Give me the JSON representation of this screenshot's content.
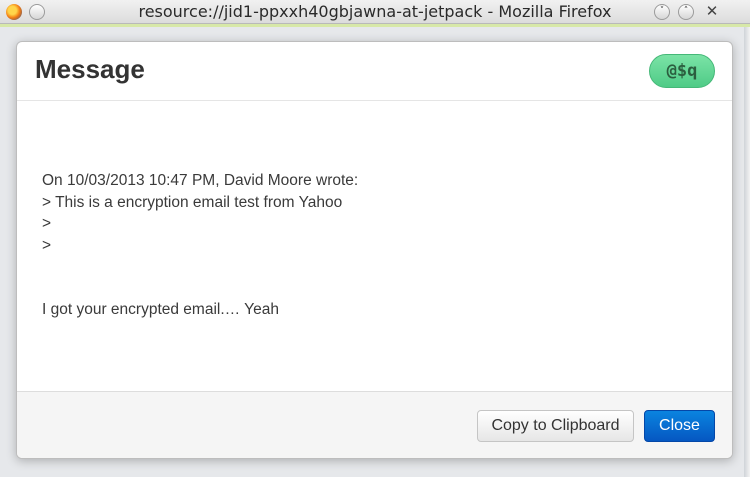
{
  "window": {
    "title": "resource://jid1-ppxxh40gbjawna-at-jetpack - Mozilla Firefox",
    "min_symbol": "˅",
    "max_symbol": "˄",
    "close_symbol": "✕"
  },
  "modal": {
    "title": "Message",
    "badge": "@$q",
    "body_lines": [
      "On 10/03/2013 10:47 PM, David Moore wrote:",
      "> This is a encryption email test from Yahoo",
      ">",
      ">",
      "",
      "",
      "I got your encrypted email.… Yeah"
    ],
    "buttons": {
      "copy": "Copy to Clipboard",
      "close": "Close"
    }
  },
  "colors": {
    "badge": "#5fd594",
    "primary_button": "#0560cc"
  }
}
